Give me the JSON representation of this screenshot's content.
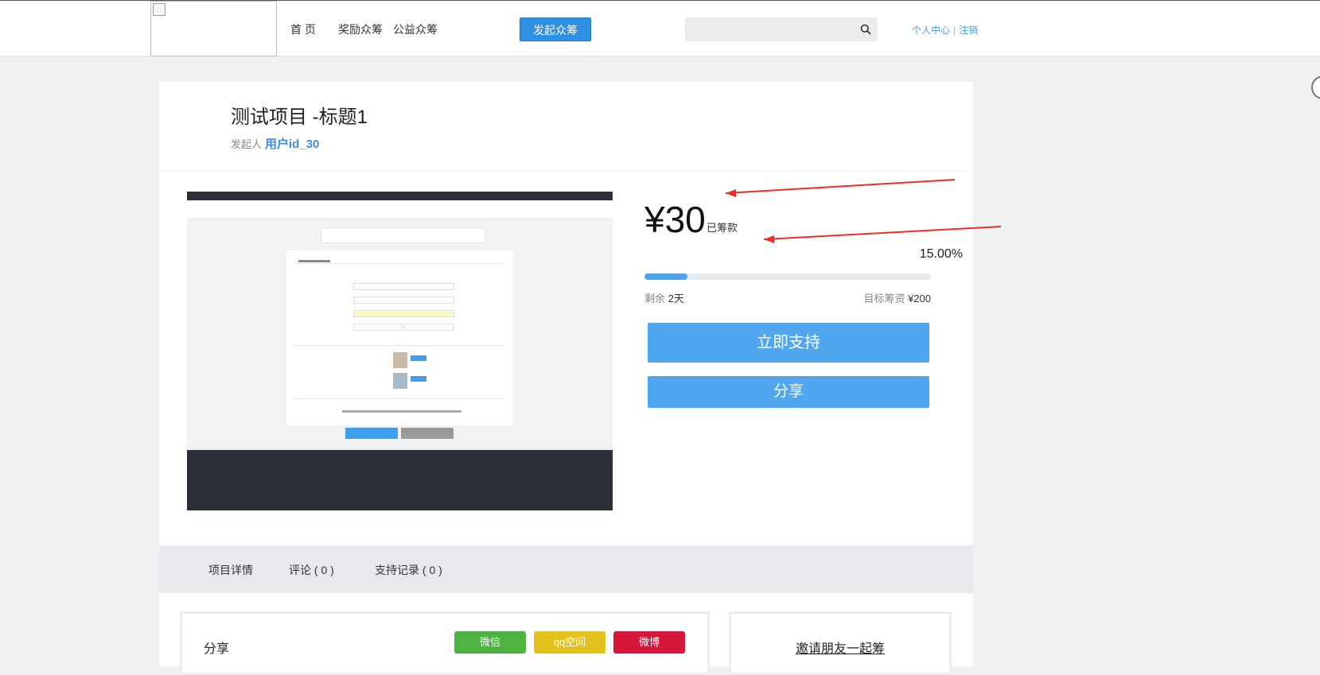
{
  "header": {
    "nav": [
      "首 页",
      "奖励众筹",
      "公益众筹"
    ],
    "launch_button": "发起众筹",
    "search": {
      "value": "",
      "placeholder": ""
    },
    "user_center": "个人中心",
    "logout": "注销",
    "icons": {
      "search": "search-icon",
      "logo": "broken-image-icon"
    }
  },
  "project": {
    "title": "测试项目 -标题1",
    "initiator_label": "发起人",
    "initiator": "用户id_30",
    "amount": "¥30",
    "amount_label": "已筹款",
    "percent": "15.00%",
    "progress": 0.15,
    "remain_label": "剩余",
    "remain_value": "2天",
    "target_label": "目标筹资",
    "target_value": "¥200",
    "support_button": "立即支持",
    "share_button": "分享"
  },
  "tabs": [
    "项目详情",
    "评论 ( 0 )",
    "支持记录 ( 0 )"
  ],
  "share_panel": {
    "title": "分享",
    "buttons": [
      {
        "label": "微信",
        "color": "#4fb344"
      },
      {
        "label": "qq空间",
        "color": "#e3c21e"
      },
      {
        "label": "微博",
        "color": "#d5183a"
      }
    ]
  },
  "invite": "邀请朋友一起筹",
  "colors": {
    "accent": "#50a7ef",
    "link": "#3a8de0",
    "annotation_arrow": "#e8302a"
  }
}
